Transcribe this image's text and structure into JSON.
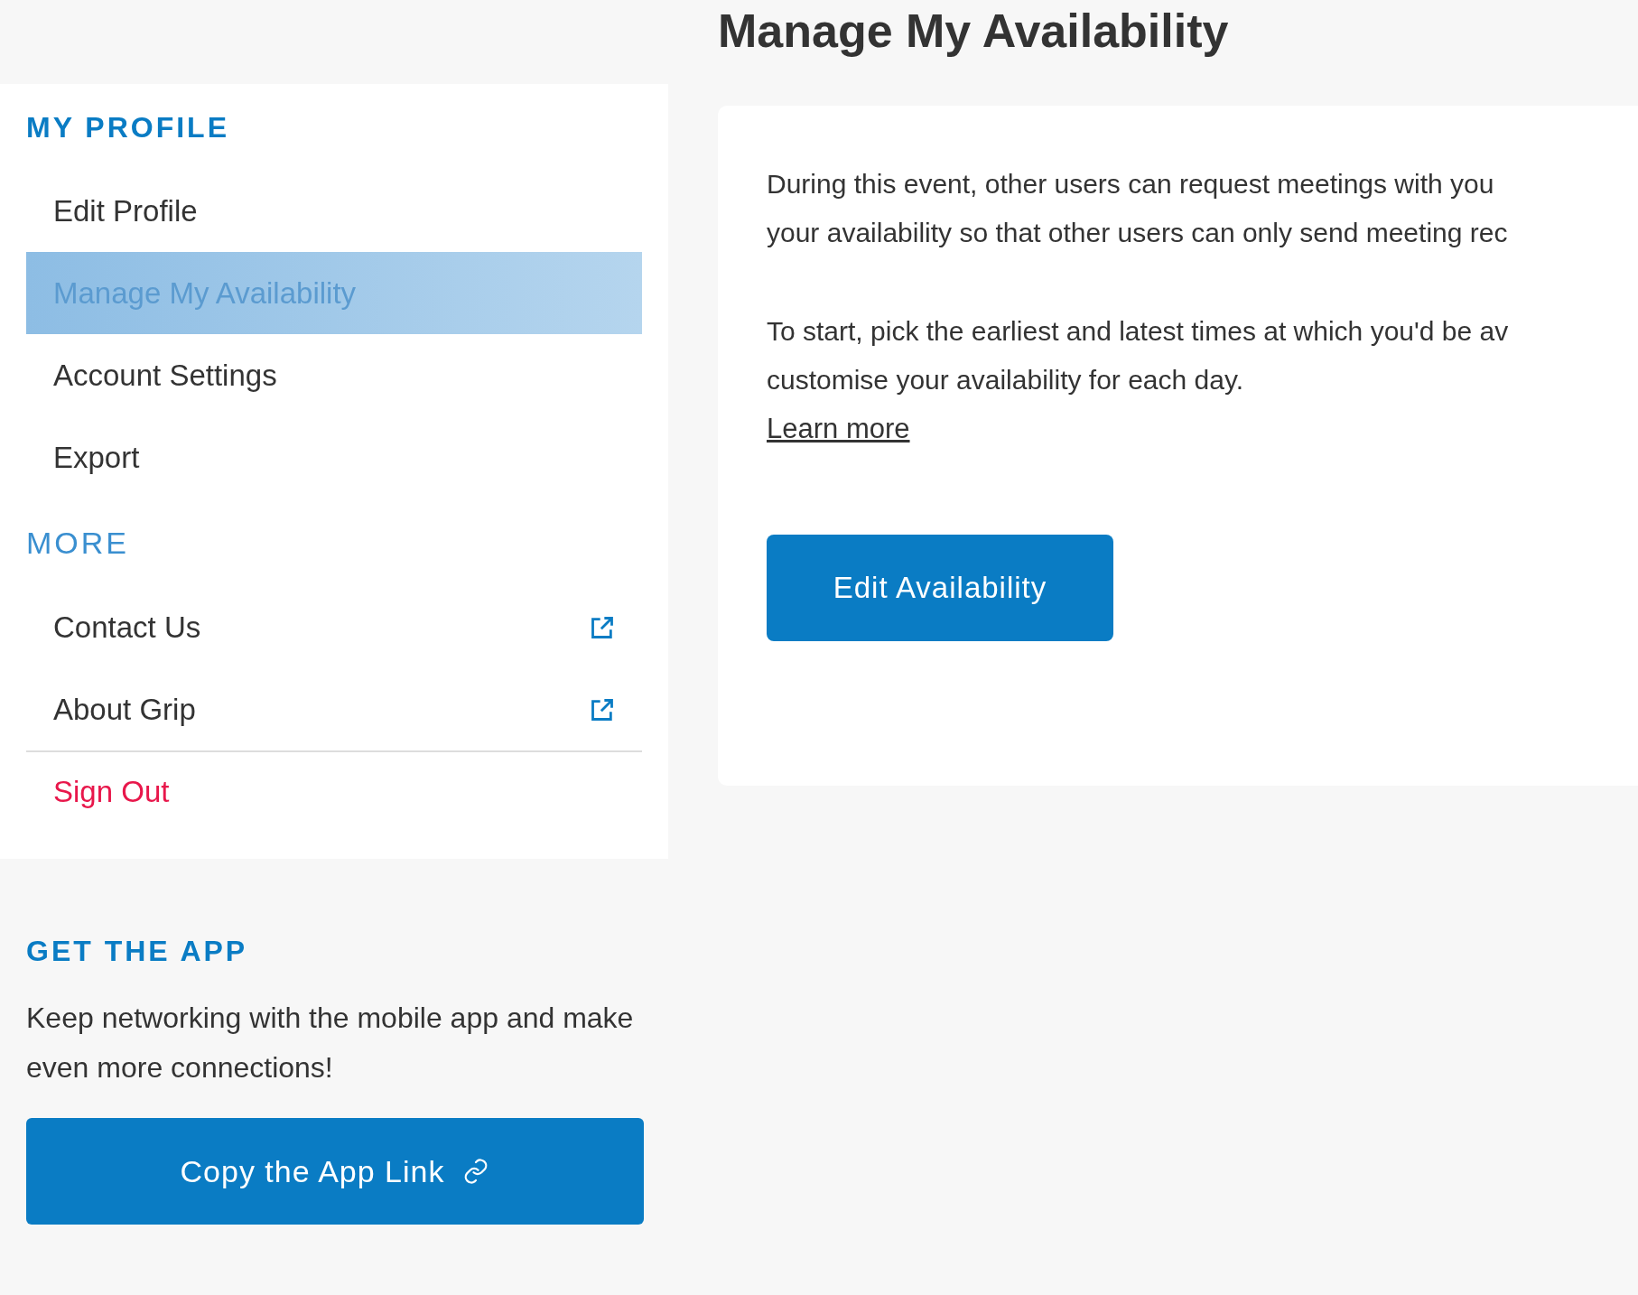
{
  "page_title": "Manage My Availability",
  "sidebar": {
    "sections": [
      {
        "heading": "MY PROFILE",
        "kind": "bold",
        "items": [
          {
            "label": "Edit Profile",
            "selected": false,
            "external": false,
            "kind": "link"
          },
          {
            "label": "Manage My Availability",
            "selected": true,
            "external": false,
            "kind": "link"
          },
          {
            "label": "Account Settings",
            "selected": false,
            "external": false,
            "kind": "link"
          },
          {
            "label": "Export",
            "selected": false,
            "external": false,
            "kind": "link"
          }
        ]
      },
      {
        "heading": "MORE",
        "kind": "light",
        "items": [
          {
            "label": "Contact Us",
            "selected": false,
            "external": true,
            "kind": "link"
          },
          {
            "label": "About Grip",
            "selected": false,
            "external": true,
            "kind": "link"
          },
          {
            "label": "Sign Out",
            "kind": "danger"
          }
        ]
      }
    ]
  },
  "get_app": {
    "heading": "GET THE APP",
    "text": "Keep networking with the mobile app and make even more connections!",
    "button": "Copy the App Link"
  },
  "card": {
    "paragraphs": [
      [
        "During this event, other users can request meetings with you",
        "your availability so that other users can only send meeting rec"
      ],
      [
        "To start, pick the earliest and latest times at which you'd be av",
        "customise your availability for each day."
      ]
    ],
    "link": "Learn more",
    "button": "Edit Availability"
  }
}
